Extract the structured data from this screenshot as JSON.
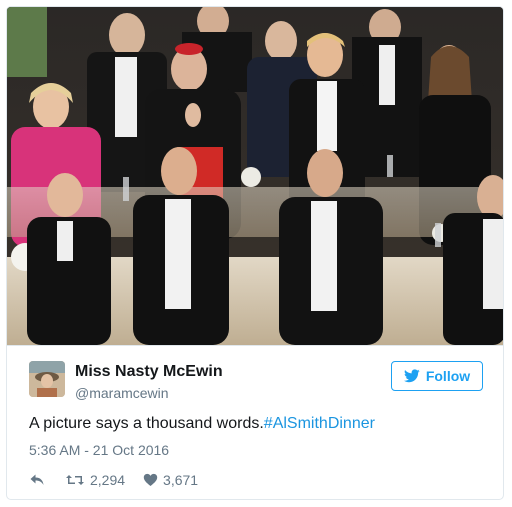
{
  "tweet": {
    "author": {
      "display_name": "Miss Nasty McEwin",
      "handle": "@maramcewin"
    },
    "follow_label": "Follow",
    "text": "A picture says a thousand words.",
    "hashtag": "#AlSmithDinner",
    "timestamp": "5:36 AM - 21 Oct 2016",
    "retweets": "2,294",
    "likes": "3,671"
  },
  "icons": {
    "follow": "twitter-bird-icon",
    "reply": "reply-arrow-icon",
    "retweet": "retweet-icon",
    "like": "heart-icon"
  },
  "colors": {
    "accent": "#1da1f2",
    "hashtag": "#1b95e0",
    "secondary_text": "#657786",
    "border": "#e1e8ed"
  }
}
